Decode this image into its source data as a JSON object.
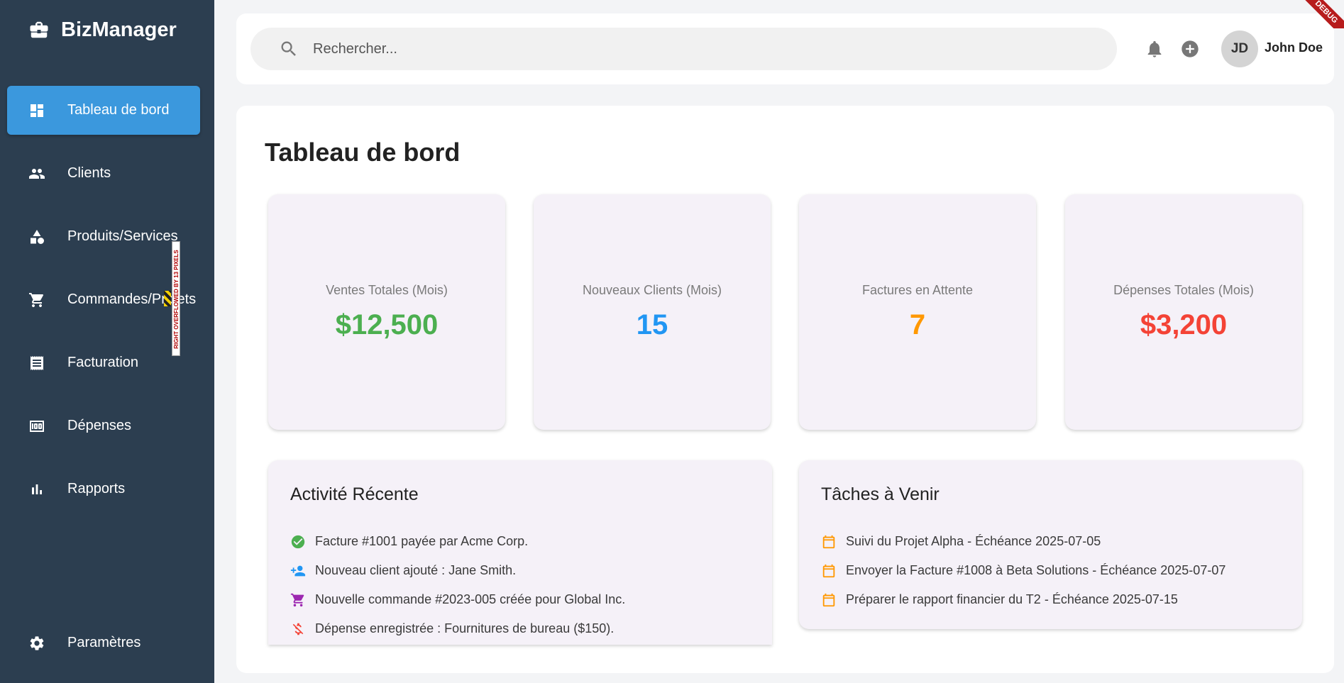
{
  "app": {
    "brand": "BizManager"
  },
  "sidebar": {
    "items": [
      {
        "label": "Tableau de bord",
        "icon": "dashboard-icon",
        "active": true
      },
      {
        "label": "Clients",
        "icon": "people-icon"
      },
      {
        "label": "Produits/Services",
        "icon": "category-icon"
      },
      {
        "label": "Commandes/Projets",
        "icon": "cart-icon"
      },
      {
        "label": "Facturation",
        "icon": "receipt-icon"
      },
      {
        "label": "Dépenses",
        "icon": "money-icon"
      },
      {
        "label": "Rapports",
        "icon": "bar-chart-icon"
      }
    ],
    "settings": {
      "label": "Paramètres",
      "icon": "gear-icon"
    },
    "overflow_warning": "RIGHT OVERFLOWED BY 13 PIXELS"
  },
  "header": {
    "search_placeholder": "Rechercher...",
    "user_initials": "JD",
    "user_name": "John Doe",
    "debug_banner": "DEBUG"
  },
  "main": {
    "title": "Tableau de bord",
    "stats": [
      {
        "label": "Ventes Totales (Mois)",
        "value": "$12,500",
        "color": "#4caf50"
      },
      {
        "label": "Nouveaux Clients (Mois)",
        "value": "15",
        "color": "#2196f3"
      },
      {
        "label": "Factures en Attente",
        "value": "7",
        "color": "#ff9800"
      },
      {
        "label": "Dépenses Totales (Mois)",
        "value": "$3,200",
        "color": "#f44336"
      }
    ],
    "recent_activity": {
      "title": "Activité Récente",
      "items": [
        {
          "text": "Facture #1001 payée par Acme Corp.",
          "icon": "check-circle-icon",
          "color": "#4caf50"
        },
        {
          "text": "Nouveau client ajouté : Jane Smith.",
          "icon": "person-add-icon",
          "color": "#2196f3"
        },
        {
          "text": "Nouvelle commande #2023-005 créée pour Global Inc.",
          "icon": "cart-icon",
          "color": "#9c27b0"
        },
        {
          "text": "Dépense enregistrée : Fournitures de bureau ($150).",
          "icon": "money-off-icon",
          "color": "#f44336"
        }
      ]
    },
    "upcoming_tasks": {
      "title": "Tâches à Venir",
      "items": [
        {
          "text": "Suivi du Projet Alpha - Échéance 2025-07-05",
          "icon": "calendar-icon",
          "color": "#ff9800"
        },
        {
          "text": "Envoyer la Facture #1008 à Beta Solutions - Échéance 2025-07-07",
          "icon": "calendar-icon",
          "color": "#ff9800"
        },
        {
          "text": "Préparer le rapport financier du T2 - Échéance 2025-07-15",
          "icon": "calendar-icon",
          "color": "#ff9800"
        }
      ]
    }
  }
}
